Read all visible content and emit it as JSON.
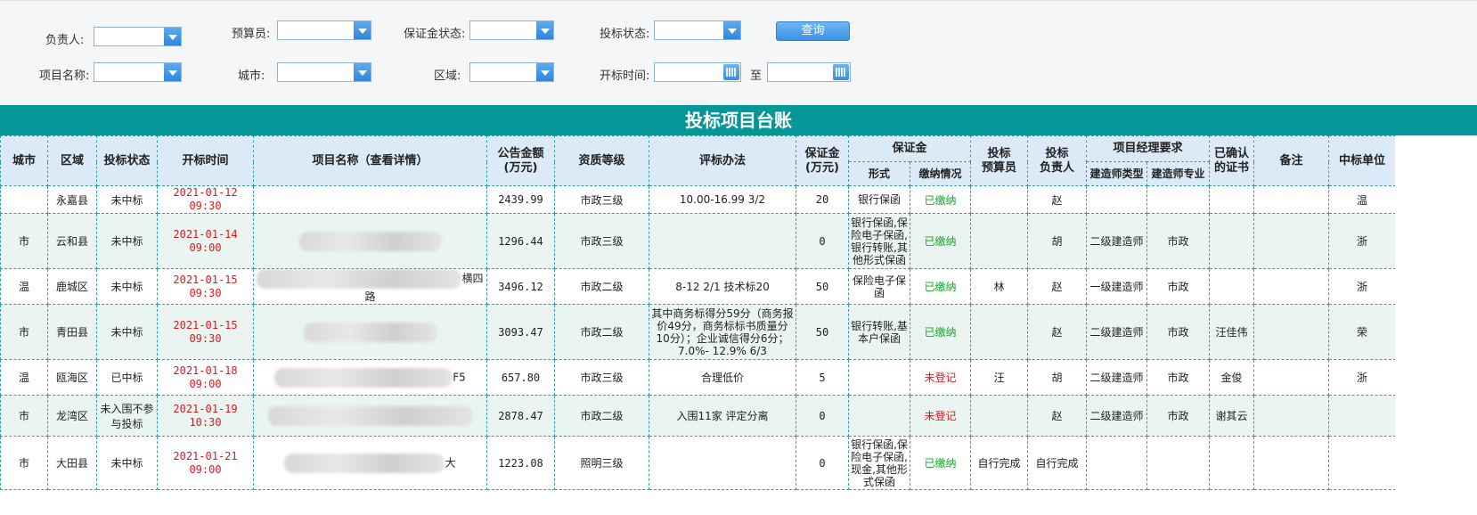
{
  "filters": {
    "owner_label": "负责人:",
    "budgeter_label": "预算员:",
    "deposit_status_label": "保证金状态:",
    "bid_status_label": "投标状态:",
    "query_label": "查询",
    "project_name_label": "项目名称:",
    "city_label": "城市:",
    "region_label": "区域:",
    "open_time_label": "开标时间:",
    "to_label": "至"
  },
  "title": "投标项目台账",
  "table": {
    "headers": {
      "city": "城市",
      "region": "区域",
      "bid_status": "投标状态",
      "open_time": "开标时间",
      "project_name": "项目名称（查看详情）",
      "amount": "公告金额\n(万元)",
      "qualification": "资质等级",
      "evaluation": "评标办法",
      "deposit_amount": "保证金\n(万元)",
      "deposit_group": "保证金",
      "deposit_form": "形式",
      "deposit_payment": "缴纳情况",
      "bid_budgeter": "投标\n预算员",
      "bid_owner": "投标\n负责人",
      "pm_group": "项目经理要求",
      "pm_type": "建造师类型",
      "pm_specialty": "建造师专业",
      "confirmed_cert": "已确认\n的证书",
      "remark": "备注",
      "winner": "中标单位"
    },
    "rows": [
      {
        "city": "",
        "region": "永嘉县",
        "status": "未中标",
        "date": "2021-01-12",
        "time": "09:30",
        "project": "",
        "amount": "2439.99",
        "qual": "市政三级",
        "eval": "10.00-16.99 3/2",
        "deposit": "20",
        "form": "银行保函",
        "payment": "已缴纳",
        "budgeter": "",
        "owner": "赵",
        "pm_type": "",
        "pm_spec": "",
        "cert": "",
        "remark": "",
        "winner": "温"
      },
      {
        "city": "市",
        "region": "云和县",
        "status": "未中标",
        "date": "2021-01-14",
        "time": "09:00",
        "project": "",
        "amount": "1296.44",
        "qual": "市政三级",
        "eval": "",
        "deposit": "0",
        "form": "银行保函,保险电子保函,银行转账,其他形式保函",
        "payment": "已缴纳",
        "budgeter": "",
        "owner": "胡",
        "pm_type": "二级建造师",
        "pm_spec": "市政",
        "cert": "",
        "remark": "",
        "winner": "浙"
      },
      {
        "city": "温",
        "region": "鹿城区",
        "status": "未中标",
        "date": "2021-01-15",
        "time": "09:30",
        "project": "横四路",
        "amount": "3496.12",
        "qual": "市政二级",
        "eval": "8-12 2/1 技术标20",
        "deposit": "50",
        "form": "保险电子保函",
        "payment": "已缴纳",
        "budgeter": "林",
        "owner": "赵",
        "pm_type": "一级建造师",
        "pm_spec": "市政",
        "cert": "",
        "remark": "",
        "winner": "浙"
      },
      {
        "city": "市",
        "region": "青田县",
        "status": "未中标",
        "date": "2021-01-15",
        "time": "09:30",
        "project": "",
        "amount": "3093.47",
        "qual": "市政二级",
        "eval": "其中商务标得分59分（商务报价49分，商务标标书质量分10分）；企业诚信得分6分；7.0%- 12.9% 6/3",
        "deposit": "50",
        "form": "银行转账,基本户保函",
        "payment": "已缴纳",
        "budgeter": "",
        "owner": "赵",
        "pm_type": "二级建造师",
        "pm_spec": "市政",
        "cert": "汪佳伟",
        "remark": "",
        "winner": "荣"
      },
      {
        "city": "温",
        "region": "瓯海区",
        "status": "已中标",
        "date": "2021-01-18",
        "time": "09:00",
        "project": "F5",
        "amount": "657.80",
        "qual": "市政三级",
        "eval": "合理低价",
        "deposit": "5",
        "form": "",
        "payment": "未登记",
        "budgeter": "汪",
        "owner": "胡",
        "pm_type": "二级建造师",
        "pm_spec": "市政",
        "cert": "金俊",
        "remark": "",
        "winner": "浙"
      },
      {
        "city": "市",
        "region": "龙湾区",
        "status": "未入围不参与投标",
        "date": "2021-01-19",
        "time": "10:30",
        "project": "",
        "amount": "2878.47",
        "qual": "市政二级",
        "eval": "入围11家 评定分离",
        "deposit": "0",
        "form": "",
        "payment": "未登记",
        "budgeter": "",
        "owner": "赵",
        "pm_type": "二级建造师",
        "pm_spec": "市政",
        "cert": "谢其云",
        "remark": "",
        "winner": ""
      },
      {
        "city": "市",
        "region": "大田县",
        "status": "未中标",
        "date": "2021-01-21",
        "time": "09:00",
        "project": "大",
        "amount": "1223.08",
        "qual": "照明三级",
        "eval": "",
        "deposit": "0",
        "form": "银行保函,保险电子保函,现金,其他形式保函",
        "payment": "已缴纳",
        "budgeter": "自行完成",
        "owner": "自行完成",
        "pm_type": "",
        "pm_spec": "",
        "cert": "",
        "remark": "",
        "winner": ""
      }
    ]
  }
}
